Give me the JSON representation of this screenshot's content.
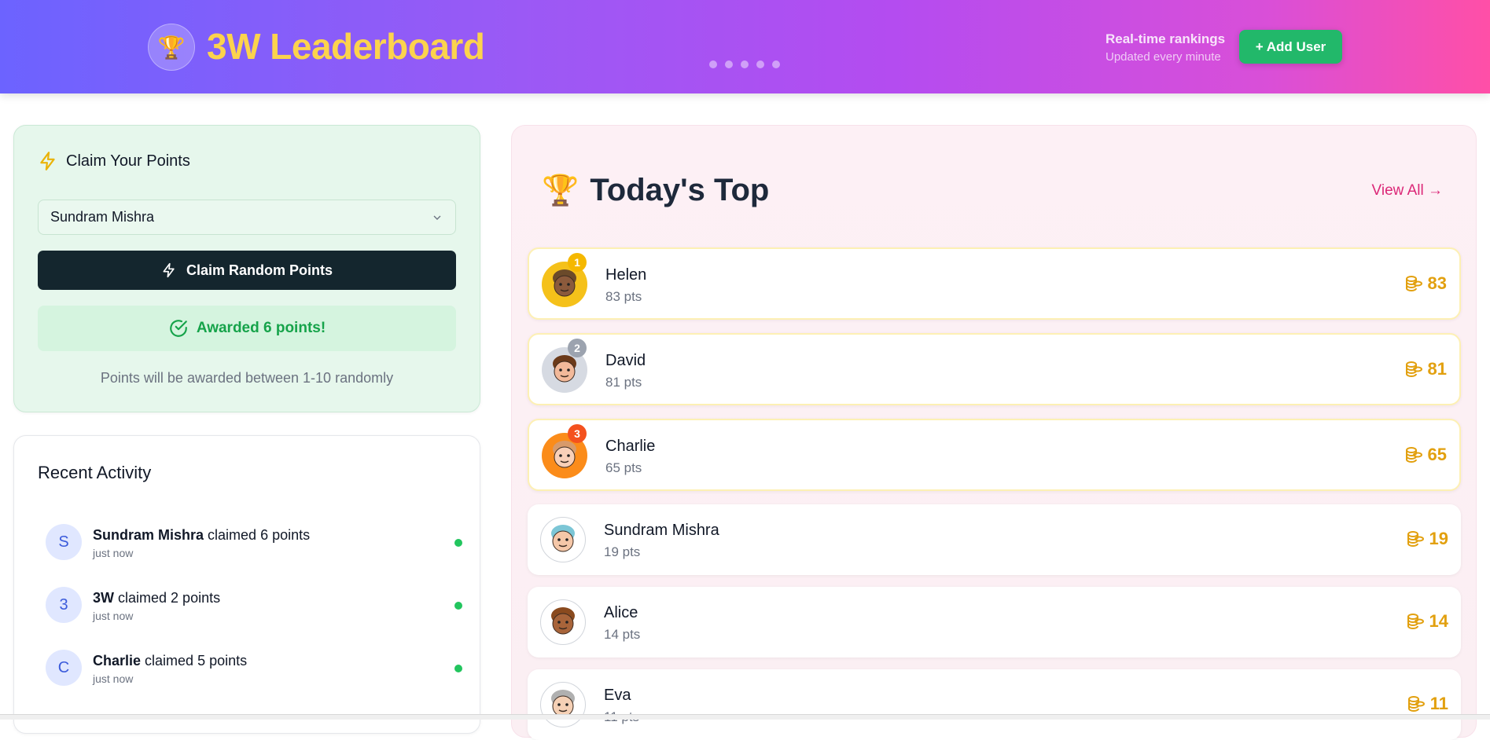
{
  "header": {
    "logo_icon": "trophy-icon",
    "title": "3W Leaderboard",
    "realtime_title": "Real-time rankings",
    "realtime_sub": "Updated every minute",
    "add_user_label": "+ Add User",
    "dots": 5
  },
  "claim": {
    "heading": "Claim Your Points",
    "selected_user": "Sundram Mishra",
    "button_label": "Claim Random Points",
    "awarded_message": "Awarded 6 points!",
    "note": "Points will be awarded between 1-10 randomly"
  },
  "activity": {
    "title": "Recent Activity",
    "items": [
      {
        "initial": "S",
        "name": "Sundram Mishra",
        "action": "claimed 6 points",
        "time": "just now"
      },
      {
        "initial": "3",
        "name": "3W",
        "action": "claimed 2 points",
        "time": "just now"
      },
      {
        "initial": "C",
        "name": "Charlie",
        "action": "claimed 5 points",
        "time": "just now"
      }
    ]
  },
  "board": {
    "title": "Today's Top",
    "view_all": "View All →",
    "rows": [
      {
        "rank": "1",
        "name": "Helen",
        "pts": "83 pts",
        "score": "83",
        "avatar_bg": "#f5c11a",
        "badge_bg": "#f5b800",
        "skin": "#8b5a3c",
        "hair": "#6b4a2a"
      },
      {
        "rank": "2",
        "name": "David",
        "pts": "81 pts",
        "score": "81",
        "avatar_bg": "#d6dae2",
        "badge_bg": "#9ca3af",
        "skin": "#f2b99a",
        "hair": "#6b3a1a"
      },
      {
        "rank": "3",
        "name": "Charlie",
        "pts": "65 pts",
        "score": "65",
        "avatar_bg": "#fb8c1a",
        "badge_bg": "#f4511e",
        "skin": "#f8d0b8",
        "hair": "#d89a6a"
      },
      {
        "rank": "",
        "name": "Sundram Mishra",
        "pts": "19 pts",
        "score": "19",
        "avatar_bg": "#ffffff",
        "badge_bg": "",
        "skin": "#f5c7a8",
        "hair": "#7cc6d6"
      },
      {
        "rank": "",
        "name": "Alice",
        "pts": "14 pts",
        "score": "14",
        "avatar_bg": "#ffffff",
        "badge_bg": "",
        "skin": "#a8643a",
        "hair": "#8a4a1e"
      },
      {
        "rank": "",
        "name": "Eva",
        "pts": "11 pts",
        "score": "11",
        "avatar_bg": "#ffffff",
        "badge_bg": "",
        "skin": "#f5d0b5",
        "hair": "#b0b0b0"
      }
    ]
  },
  "colors": {
    "accent_green": "#22b86a",
    "gold": "#e2a00f",
    "pink_link": "#db2777"
  }
}
